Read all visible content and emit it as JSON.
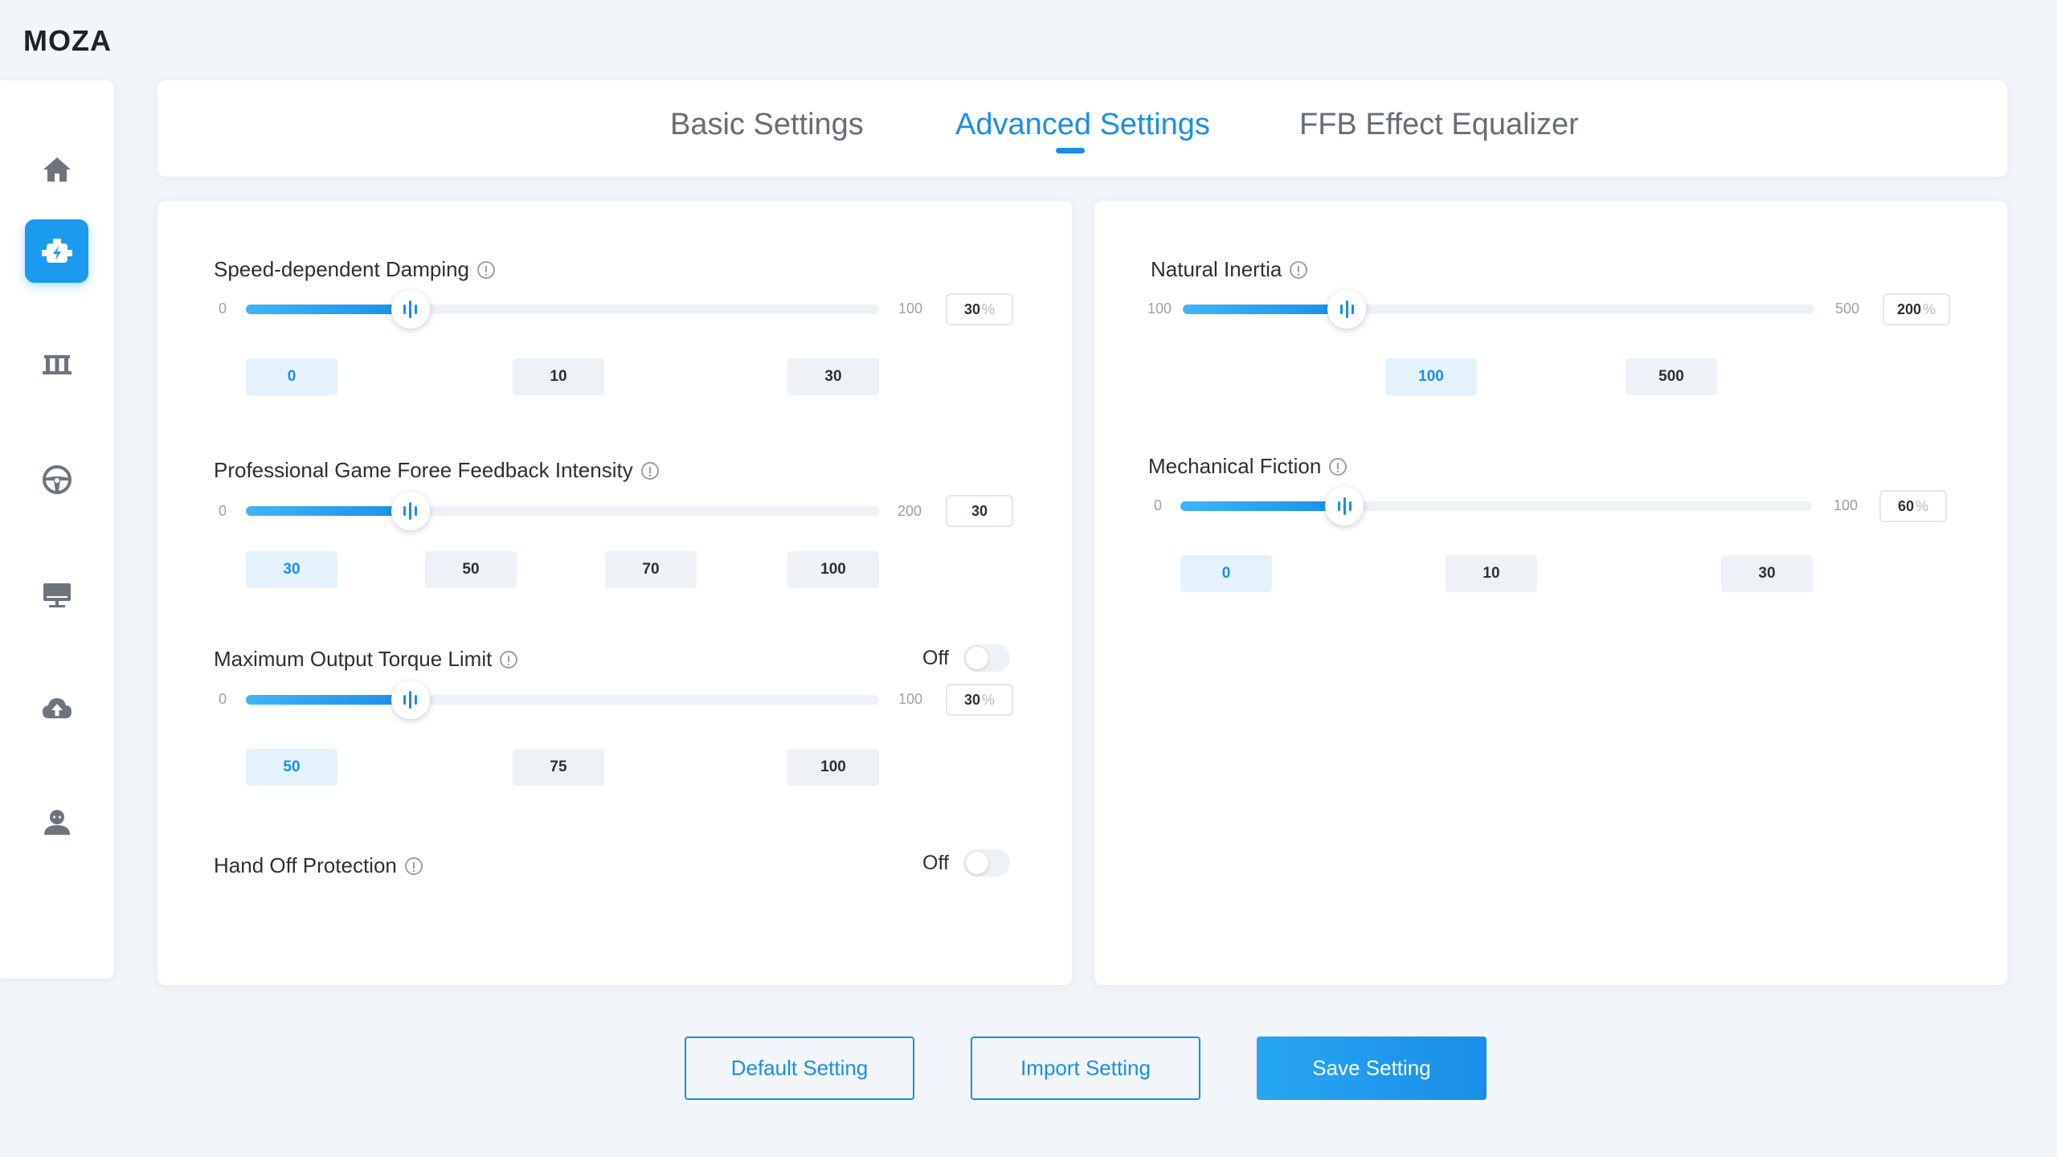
{
  "app": {
    "logo": "MOZA"
  },
  "sidebar": {
    "items": [
      {
        "icon": "home-icon"
      },
      {
        "icon": "wheelbase-icon",
        "active": true
      },
      {
        "icon": "pedals-icon"
      },
      {
        "icon": "steering-wheel-icon"
      },
      {
        "icon": "dashboard-icon"
      },
      {
        "icon": "cloud-upload-icon"
      },
      {
        "icon": "user-icon"
      }
    ]
  },
  "tabs": [
    {
      "label": "Basic Settings"
    },
    {
      "label": "Advanced Settings",
      "active": true
    },
    {
      "label": "FFB Effect Equalizer"
    }
  ],
  "left_panel": {
    "speed_damping": {
      "label": "Speed-dependent Damping",
      "min": "0",
      "max": "100",
      "value": "30",
      "unit": "%",
      "fill_fraction": 0.26,
      "presets": [
        "0",
        "10",
        "30"
      ],
      "selected_preset": "0"
    },
    "game_ffb": {
      "label": "Professional Game Foree Feedback Intensity",
      "min": "0",
      "max": "200",
      "value": "30",
      "fill_fraction": 0.26,
      "presets": [
        "30",
        "50",
        "70",
        "100"
      ],
      "selected_preset": "30"
    },
    "torque_limit": {
      "label": "Maximum Output Torque Limit",
      "toggle_label": "Off",
      "min": "0",
      "max": "100",
      "value": "30",
      "unit": "%",
      "fill_fraction": 0.26,
      "presets": [
        "50",
        "75",
        "100"
      ],
      "selected_preset": "50"
    },
    "hand_off": {
      "label": "Hand Off Protection",
      "toggle_label": "Off"
    }
  },
  "right_panel": {
    "natural_inertia": {
      "label": "Natural Inertia",
      "min": "100",
      "max": "500",
      "value": "200",
      "unit": "%",
      "fill_fraction": 0.26,
      "presets": [
        "100",
        "500"
      ],
      "selected_preset": "100"
    },
    "mechanical_friction": {
      "label": "Mechanical Fiction",
      "min": "0",
      "max": "100",
      "value": "60",
      "unit": "%",
      "fill_fraction": 0.26,
      "presets": [
        "0",
        "10",
        "30"
      ],
      "selected_preset": "0"
    }
  },
  "actions": {
    "default_label": "Default Setting",
    "import_label": "Import Setting",
    "save_label": "Save Setting"
  },
  "colors": {
    "accent": "#1a8ee6",
    "background": "#f2f5fa"
  }
}
